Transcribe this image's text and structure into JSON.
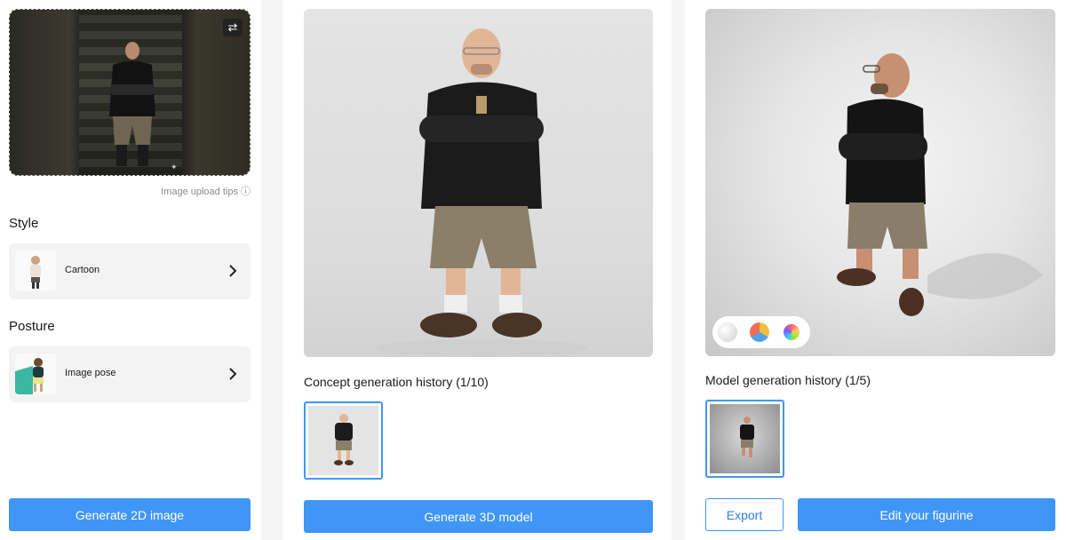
{
  "left": {
    "upload": {
      "tips_label": "Image upload tips ⓘ"
    },
    "style": {
      "title": "Style",
      "option_label": "Cartoon"
    },
    "posture": {
      "title": "Posture",
      "option_label": "Image pose"
    },
    "generate_button": "Generate 2D image"
  },
  "middle": {
    "history_title": "Concept generation history (1/10)",
    "generate_button": "Generate 3D model"
  },
  "right": {
    "history_title": "Model generation history (1/5)",
    "export_button": "Export",
    "edit_button": "Edit your figurine",
    "material_swatches": [
      "plain-white",
      "tri-color",
      "rainbow"
    ]
  },
  "colors": {
    "accent": "#4096f6",
    "panel_background": "#f3f3f3"
  }
}
